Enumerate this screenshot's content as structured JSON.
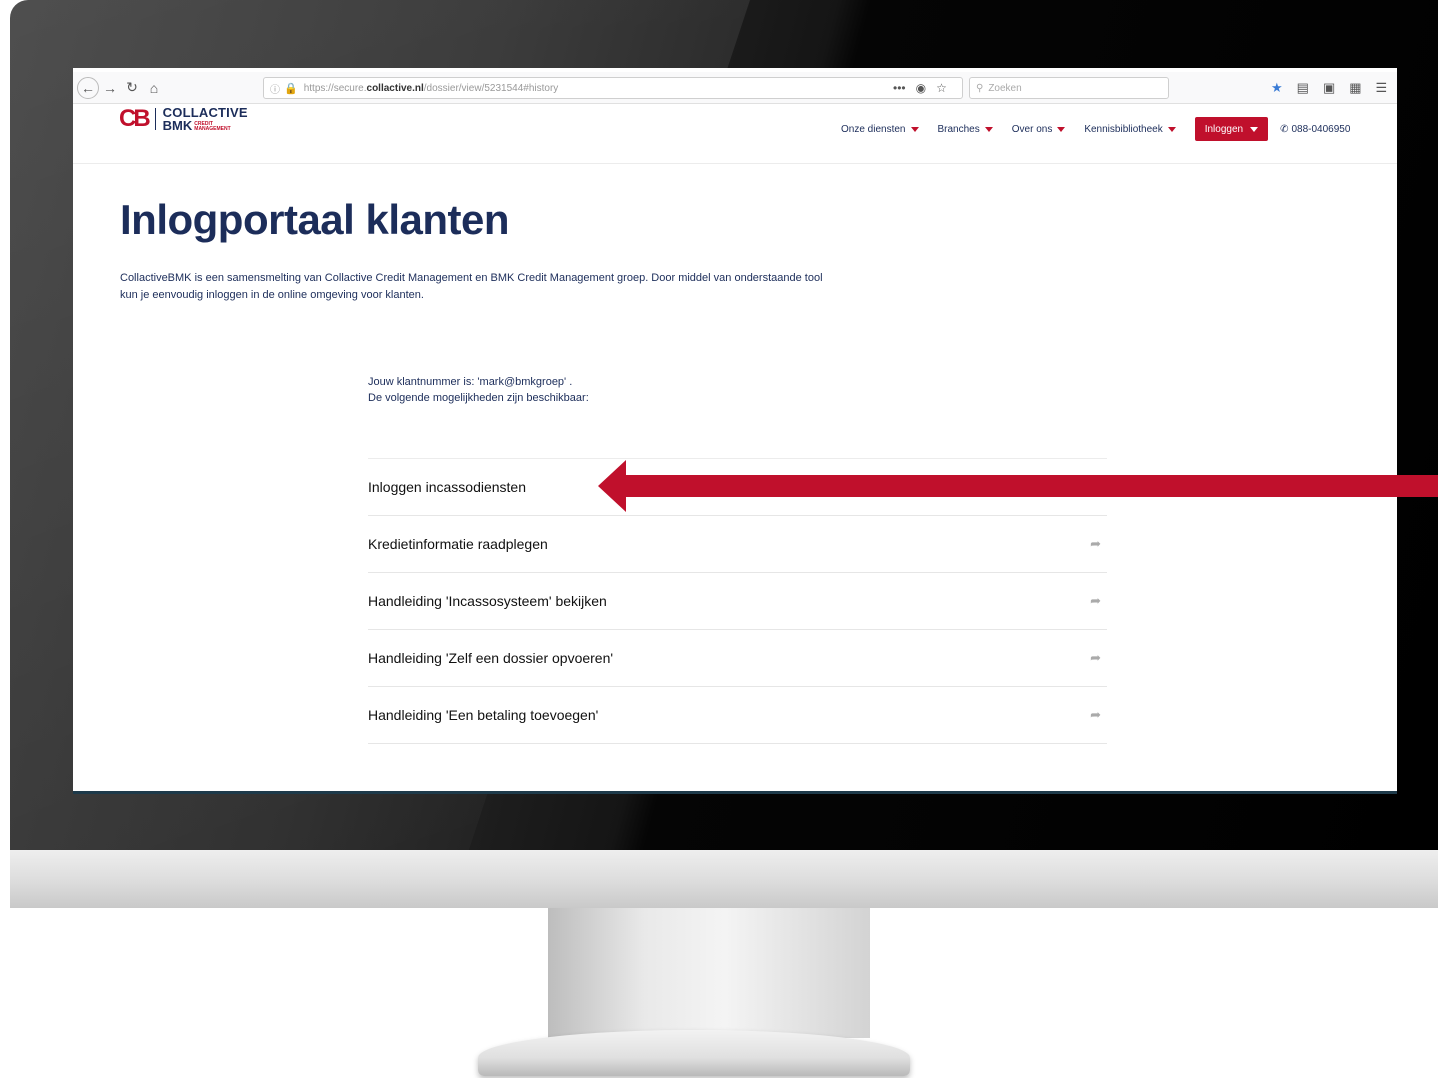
{
  "browser": {
    "url_prefix": "https://secure.",
    "url_host": "collactive.nl",
    "url_path": "/dossier/view/5231544#history",
    "search_placeholder": "Zoeken",
    "more_glyph": "•••"
  },
  "header": {
    "logo_mark": "CB",
    "logo_line1": "COLLACTIVE",
    "logo_line2": "BMK",
    "logo_sub1": "CREDIT",
    "logo_sub2": "MANAGEMENT",
    "nav": [
      {
        "label": "Onze diensten"
      },
      {
        "label": "Branches"
      },
      {
        "label": "Over ons"
      },
      {
        "label": "Kennisbibliotheek"
      }
    ],
    "login_label": "Inloggen",
    "phone": "088-0406950"
  },
  "page": {
    "title": "Inlogportaal klanten",
    "intro_line1": "CollactiveBMK is een samensmelting van Collactive Credit Management en BMK Credit Management groep. Door middel van onderstaande tool",
    "intro_line2": "kun je eenvoudig inloggen in de online omgeving voor klanten.",
    "klant_line1": "Jouw klantnummer is: 'mark@bmkgroep' .",
    "klant_line2": "De volgende mogelijkheden zijn beschikbaar:",
    "options": [
      {
        "label": "Inloggen incassodiensten",
        "has_share": false
      },
      {
        "label": "Kredietinformatie raadplegen",
        "has_share": true
      },
      {
        "label": "Handleiding 'Incassosysteem' bekijken",
        "has_share": true
      },
      {
        "label": "Handleiding 'Zelf een dossier opvoeren'",
        "has_share": true
      },
      {
        "label": "Handleiding 'Een betaling toevoegen'",
        "has_share": true
      }
    ]
  },
  "colors": {
    "brand_red": "#c0102c",
    "brand_navy": "#1c2d5a",
    "arrow": "#c0102c"
  }
}
